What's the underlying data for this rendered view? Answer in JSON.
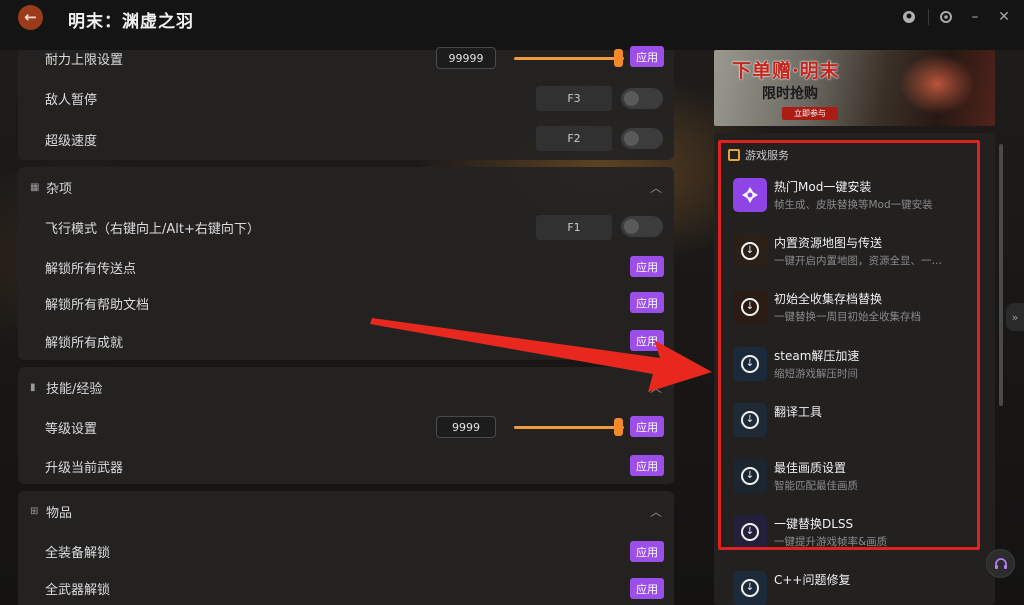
{
  "app": {
    "title": "明末：渊虚之羽"
  },
  "title_bar": {
    "back_icon": "arrow-left-icon"
  },
  "window_controls": [
    {
      "name": "user-icon",
      "glyph": "●"
    },
    {
      "name": "settings-icon",
      "glyph": "◎"
    },
    {
      "name": "minimize-icon",
      "glyph": "–"
    },
    {
      "name": "close-icon",
      "glyph": "✕"
    }
  ],
  "apply_label": "应用",
  "top_section": {
    "rows": [
      {
        "label": "耐力上限设置",
        "value": "99999",
        "slider_fraction": 1.0
      },
      {
        "label": "敌人暂停",
        "hotkey": "F3",
        "enabled": false
      },
      {
        "label": "超级速度",
        "hotkey": "F2",
        "enabled": false
      }
    ]
  },
  "misc_section": {
    "title": "杂项",
    "rows": [
      {
        "label": "飞行模式（右键向上/Alt+右键向下）",
        "hotkey": "F1",
        "enabled": false
      },
      {
        "label": "解锁所有传送点"
      },
      {
        "label": "解锁所有帮助文档"
      },
      {
        "label": "解锁所有成就"
      }
    ]
  },
  "skills_section": {
    "title": "技能/经验",
    "rows": [
      {
        "label": "等级设置",
        "value": "9999",
        "slider_fraction": 1.0
      },
      {
        "label": "升级当前武器"
      }
    ]
  },
  "items_section": {
    "title": "物品",
    "rows": [
      {
        "label": "全装备解锁"
      },
      {
        "label": "全武器解锁"
      }
    ]
  },
  "banner": {
    "title": "下单赠·明末",
    "subtitle": "限时抢购",
    "button": "立即参与"
  },
  "services": {
    "header": "游戏服务",
    "items": [
      {
        "title": "热门Mod一键安装",
        "desc": "帧生成、皮肤替换等Mod一键安装",
        "icon": "mod-icon",
        "color": "#8f45e6"
      },
      {
        "title": "内置资源地图与传送",
        "desc": "一键开启内置地图，资源全显、一…",
        "icon": "download-icon",
        "color": "#2a2018"
      },
      {
        "title": "初始全收集存档替换",
        "desc": "一键替换一周目初始全收集存档",
        "icon": "download-icon",
        "color": "#2a1c14"
      },
      {
        "title": "steam解压加速",
        "desc": "缩短游戏解压时间",
        "icon": "download-icon",
        "color": "#1a2a3a"
      },
      {
        "title": "翻译工具",
        "desc": "",
        "icon": "download-icon",
        "color": "#1e2a36"
      },
      {
        "title": "最佳画质设置",
        "desc": "智能匹配最佳画质",
        "icon": "download-icon",
        "color": "#1c2630"
      },
      {
        "title": "一键替换DLSS",
        "desc": "一键提升游戏帧率&画质",
        "icon": "download-icon",
        "color": "#241f3a"
      },
      {
        "title": "C++问题修复",
        "desc": "",
        "icon": "download-icon",
        "color": "#1c2a3a"
      }
    ]
  }
}
